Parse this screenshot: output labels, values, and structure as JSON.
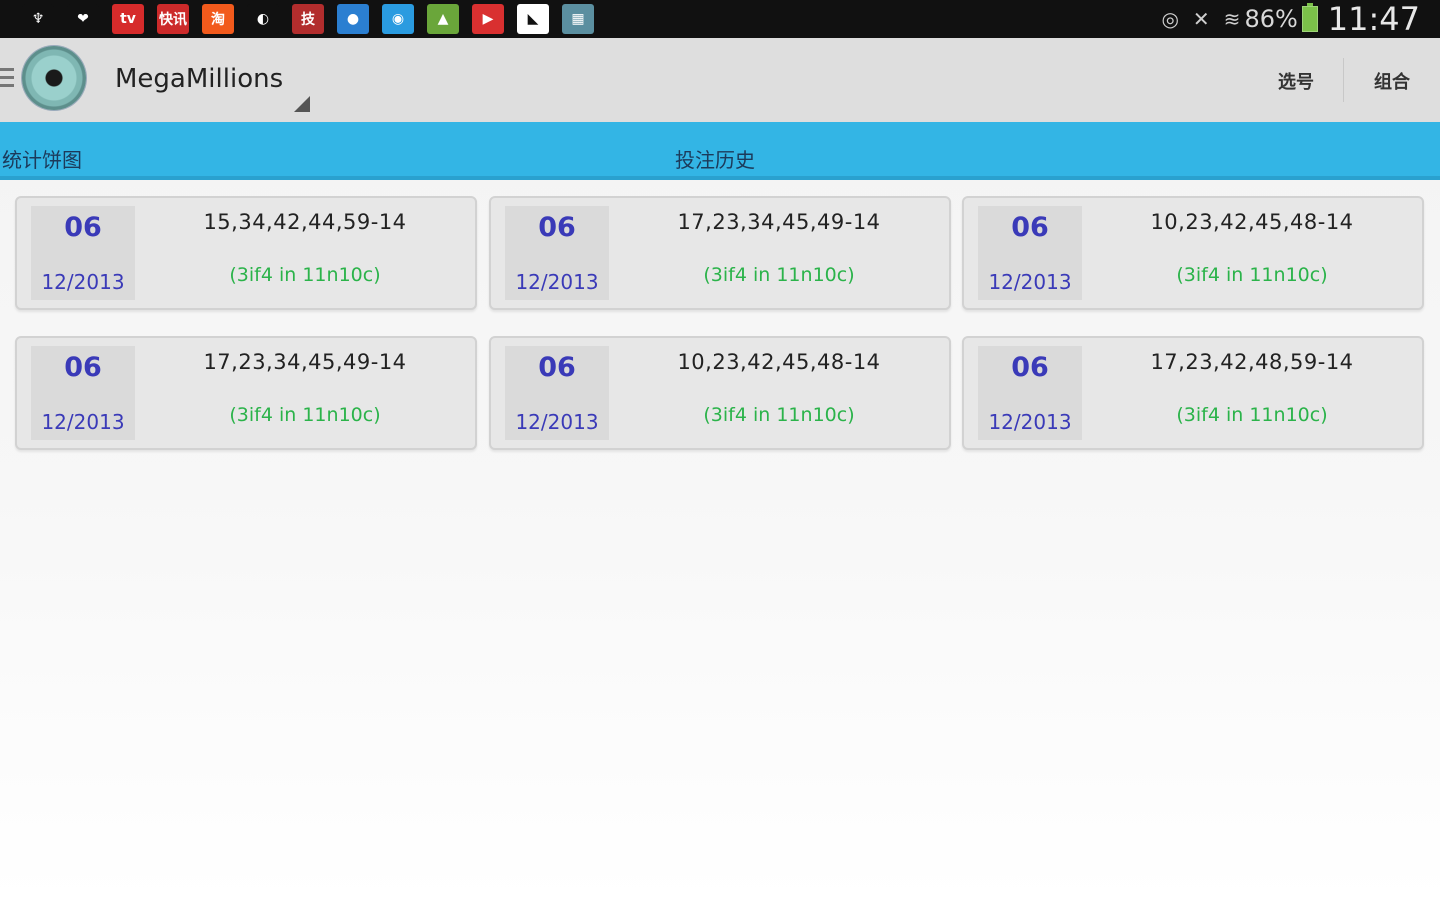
{
  "statusbar": {
    "notification_icons": [
      {
        "name": "usb-icon",
        "glyph": "♆",
        "bg": "#111111"
      },
      {
        "name": "heart-app-icon",
        "glyph": "❤",
        "bg": "#111111"
      },
      {
        "name": "tv-app-icon",
        "glyph": "tv",
        "bg": "#d62b2b"
      },
      {
        "name": "news-app-icon",
        "glyph": "快讯",
        "bg": "#cc2a2a"
      },
      {
        "name": "taobao-app-icon",
        "glyph": "淘",
        "bg": "#f25a1c"
      },
      {
        "name": "color-app-icon",
        "glyph": "◐",
        "bg": "#111111"
      },
      {
        "name": "tech-app-icon",
        "glyph": "技",
        "bg": "#b22d2d"
      },
      {
        "name": "bird-app-icon",
        "glyph": "●",
        "bg": "#2b7fd1"
      },
      {
        "name": "location-app-icon",
        "glyph": "◉",
        "bg": "#2a9be0"
      },
      {
        "name": "android-icon",
        "glyph": "▲",
        "bg": "#6aa63a"
      },
      {
        "name": "media-app-icon",
        "glyph": "▶",
        "bg": "#d93030"
      },
      {
        "name": "satellite-icon",
        "glyph": "◣",
        "bg": "#ffffff"
      },
      {
        "name": "photo-app-icon",
        "glyph": "▦",
        "bg": "#5b8fa0"
      }
    ],
    "battery_percent": "86%",
    "clock": "11:47"
  },
  "actionbar": {
    "title": "MegaMillions",
    "action_pick": "选号",
    "action_combo": "组合"
  },
  "tabs": {
    "left": "统计饼图",
    "center": "投注历史"
  },
  "tickets": [
    {
      "issue": "06",
      "date": "12/2013",
      "numbers": "15,34,42,44,59-14",
      "result": "(3if4 in 11n10c)"
    },
    {
      "issue": "06",
      "date": "12/2013",
      "numbers": "17,23,34,45,49-14",
      "result": "(3if4 in 11n10c)"
    },
    {
      "issue": "06",
      "date": "12/2013",
      "numbers": "10,23,42,45,48-14",
      "result": "(3if4 in 11n10c)"
    },
    {
      "issue": "06",
      "date": "12/2013",
      "numbers": "17,23,34,45,49-14",
      "result": "(3if4 in 11n10c)"
    },
    {
      "issue": "06",
      "date": "12/2013",
      "numbers": "10,23,42,45,48-14",
      "result": "(3if4 in 11n10c)"
    },
    {
      "issue": "06",
      "date": "12/2013",
      "numbers": "17,23,42,48,59-14",
      "result": "(3if4 in 11n10c)"
    }
  ],
  "colors": {
    "tab_bar": "#33b5e5",
    "issue_text": "#3a3ab8",
    "result_text": "#2bb34a"
  }
}
